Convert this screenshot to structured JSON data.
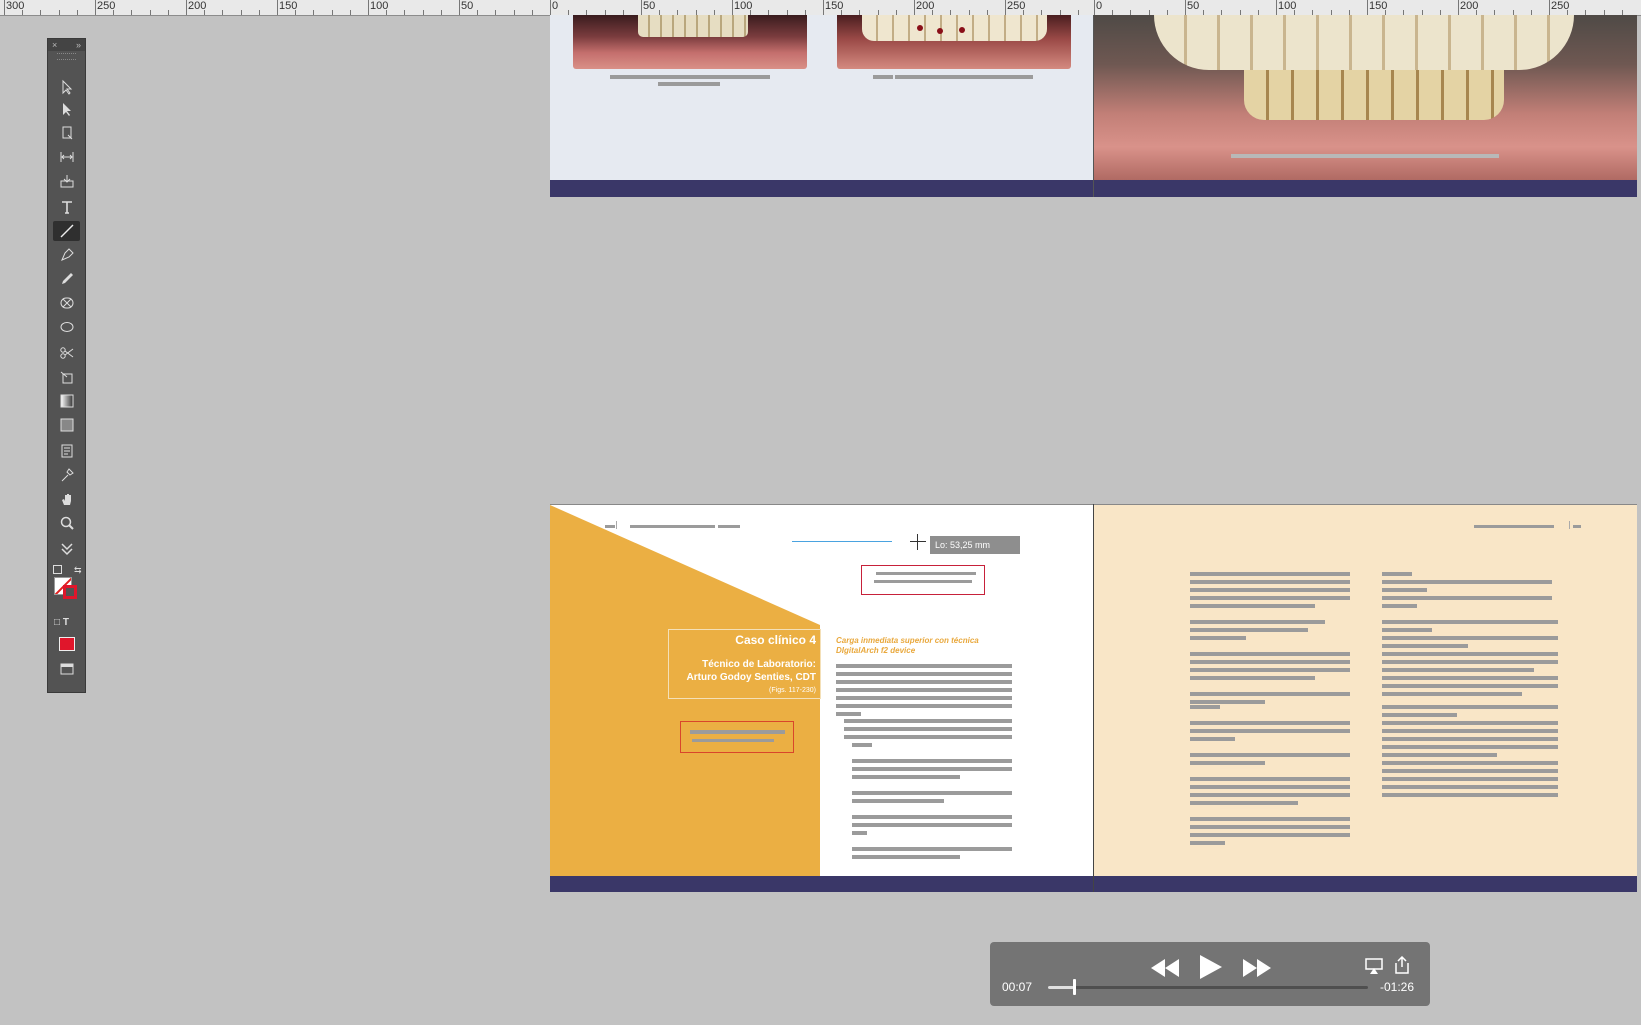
{
  "ruler": {
    "left_labels": [
      "300",
      "250",
      "200",
      "150",
      "100",
      "50"
    ],
    "mid_labels": [
      "0",
      "50",
      "100",
      "150",
      "200",
      "250"
    ],
    "right_labels": [
      "0",
      "50",
      "100",
      "150",
      "200",
      "250"
    ]
  },
  "toolbar": {
    "close_glyph": "×",
    "collapse_glyph": "»",
    "tools": [
      "selection-tool",
      "direct-selection-tool",
      "page-tool",
      "gap-tool",
      "content-collector-tool",
      "type-tool",
      "line-tool",
      "pen-tool",
      "pencil-tool",
      "rectangle-frame-tool",
      "ellipse-tool",
      "scissors-tool",
      "free-transform-tool",
      "gradient-swatch-tool",
      "gradient-feather-tool",
      "note-tool",
      "eyedropper-tool",
      "hand-tool",
      "zoom-tool"
    ],
    "format_frame_glyph": "□",
    "format_text_glyph": "T"
  },
  "spread_bottom_left": {
    "caso_title": "Caso clínico 4",
    "tecnico_line1": "Técnico de Laboratorio:",
    "tecnico_line2": "Arturo Godoy Senties, CDT",
    "figs": "(Figs. 117-230)",
    "subtitle_line1": "Carga inmediata superior con técnica",
    "subtitle_line2": "DIgitalArch f2 device"
  },
  "measure_tooltip": "Lo: 53,25 mm",
  "video": {
    "current_time": "00:07",
    "remaining_time": "-01:26",
    "progress": 0.08,
    "colors": {
      "accent": "#ffffff"
    }
  },
  "colors": {
    "orange": "#ebaf43",
    "cream": "#f9e6c7",
    "purple": "#3a3768",
    "page_blue": "#e6eaf1",
    "canvas": "#c2c2c2"
  }
}
